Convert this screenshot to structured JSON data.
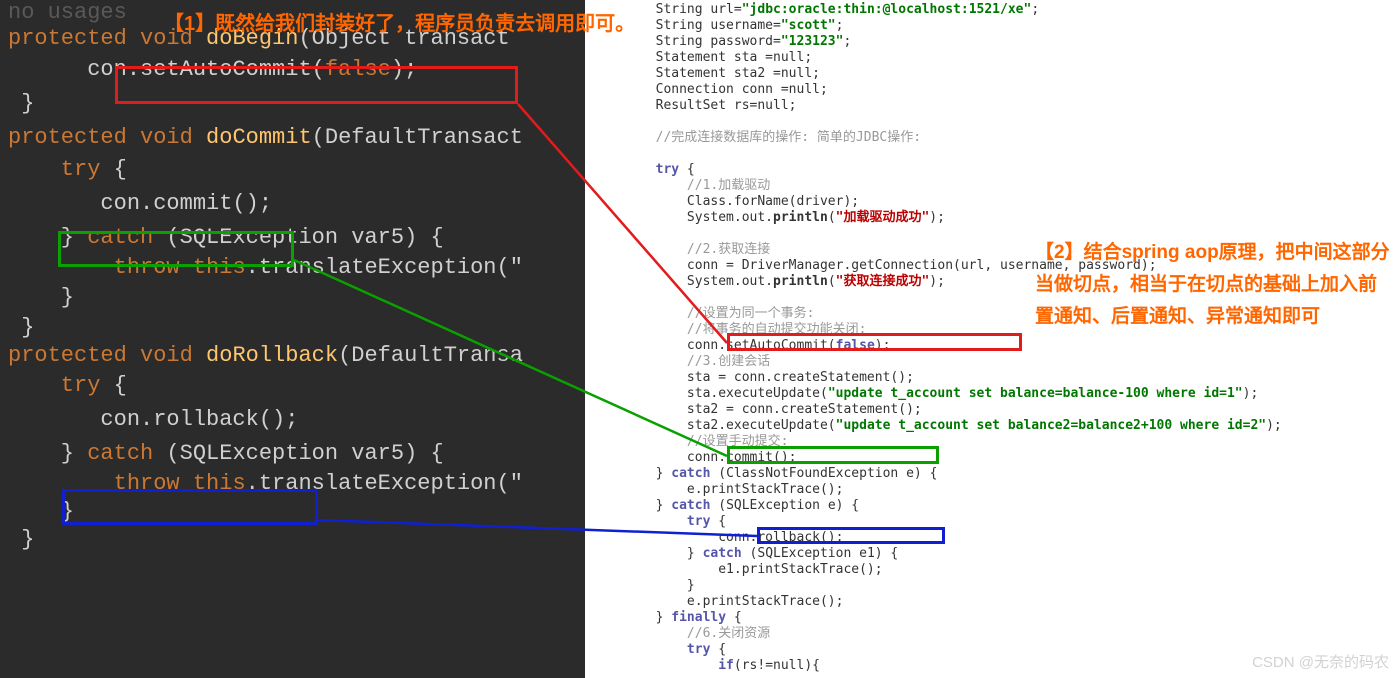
{
  "annotation1": "【1】既然给我们封装好了，程序员负责去调用即可。",
  "annotation2": "【2】结合spring aop原理，把中间这部分当做切点，相当于在切点的基础上加入前置通知、后置通知、异常通知即可",
  "watermark": "CSDN @无奈的码农",
  "left_code": {
    "l0": "no usages",
    "l1_kw": "protected void",
    "l1_mn": "doBegin",
    "l1_rest": "(Object transact",
    "l2": "      con.setAutoCommit(",
    "l2_false": "false",
    "l2_end": ");",
    "l3": " }",
    "l4_kw": "protected void",
    "l4_mn": "doCommit",
    "l4_rest": "(DefaultTransact",
    "l5_try": "    try",
    "l5_brace": " {",
    "l6": "       con.commit();",
    "l7a": "    } ",
    "l7_catch": "catch",
    "l7b": " (SQLException var5) {",
    "l8a": "        ",
    "l8_throw": "throw this",
    "l8b": ".translateException(\"",
    "l9": "    }",
    "l10": " }",
    "l11_kw": "protected void",
    "l11_mn": "doRollback",
    "l11_rest": "(DefaultTransa",
    "l12_try": "    try",
    "l12_brace": " {",
    "l13": "       con.rollback();",
    "l14a": "    } ",
    "l14_catch": "catch",
    "l14b": " (SQLException var5) {",
    "l15a": "        ",
    "l15_throw": "throw this",
    "l15b": ".translateException(\"",
    "l16": "    }",
    "l17": " }"
  },
  "right_code": {
    "r1": "        String url=",
    "r1s": "\"jdbc:oracle:thin:@localhost:1521/xe\"",
    "r1e": ";",
    "r2": "        String username=",
    "r2s": "\"scott\"",
    "r2e": ";",
    "r3": "        String password=",
    "r3s": "\"123123\"",
    "r3e": ";",
    "r4": "        Statement sta =null;",
    "r5": "        Statement sta2 =null;",
    "r6": "        Connection conn =null;",
    "r7": "        ResultSet rs=null;",
    "r8c": "        //完成连接数据库的操作: 简单的JDBC操作:",
    "r9a": "        ",
    "r9kw": "try",
    "r9b": " {",
    "r10c": "            //1.加载驱动",
    "r11": "            Class.forName(driver);",
    "r12a": "            System.out.",
    "r12m": "println",
    "r12b": "(",
    "r12s": "\"加载驱动成功\"",
    "r12e": ");",
    "r13c": "            //2.获取连接",
    "r14": "            conn = DriverManager.getConnection(url, username, password);",
    "r15a": "            System.out.",
    "r15m": "println",
    "r15b": "(",
    "r15s": "\"获取连接成功\"",
    "r15e": ");",
    "r16c": "            //设置为同一个事务:",
    "r17c": "            //将事务的自动提交功能关闭:",
    "r18a": "            conn.setAutoCommit(",
    "r18b": "false",
    "r18c": ");",
    "r19c": "            //3.创建会话",
    "r20": "            sta = conn.createStatement();",
    "r21a": "            sta.executeUpdate(",
    "r21s": "\"update t_account set balance=balance-100 where id=1\"",
    "r21e": ");",
    "r22": "            sta2 = conn.createStatement();",
    "r23a": "            sta2.executeUpdate(",
    "r23s": "\"update t_account set balance2=balance2+100 where id=2\"",
    "r23e": ");",
    "r24c": "            //设置手动提交:",
    "r25": "            conn.commit();",
    "r26a": "        } ",
    "r26kw": "catch",
    "r26b": " (ClassNotFoundException e) {",
    "r27": "            e.printStackTrace();",
    "r28a": "        } ",
    "r28kw": "catch",
    "r28b": " (SQLException e) {",
    "r29a": "            ",
    "r29kw": "try",
    "r29b": " {",
    "r30": "                conn.rollback();",
    "r31a": "            } ",
    "r31kw": "catch",
    "r31b": " (SQLException e1) {",
    "r32": "                e1.printStackTrace();",
    "r33": "            }",
    "r34": "            e.printStackTrace();",
    "r35a": "        } ",
    "r35kw": "finally",
    "r35b": " {",
    "r36c": "            //6.关闭资源",
    "r37a": "            ",
    "r37kw": "try",
    "r37b": " {",
    "r38a": "                ",
    "r38kw": "if",
    "r38b": "(rs!=null){"
  }
}
